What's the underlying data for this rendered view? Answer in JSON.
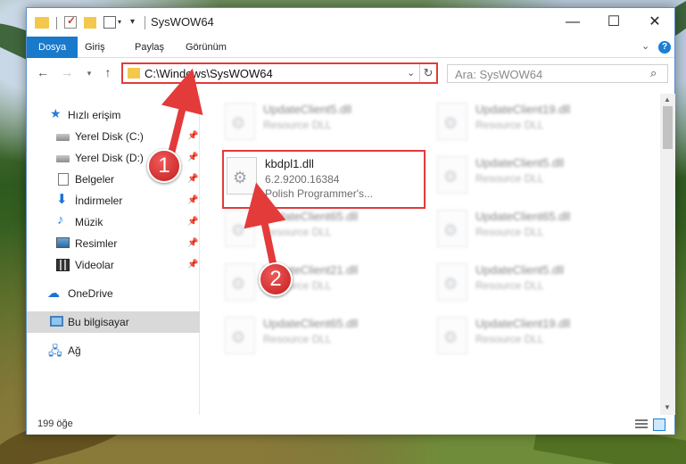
{
  "window": {
    "title": "SysWOW64",
    "controls": {
      "minimize": "—",
      "maximize": "☐",
      "close": "✕"
    }
  },
  "ribbon": {
    "tabs": [
      {
        "label": "Dosya",
        "active": true
      },
      {
        "label": "Giriş"
      },
      {
        "label": "Paylaş"
      },
      {
        "label": "Görünüm"
      }
    ],
    "help": "?"
  },
  "navigation": {
    "address": "C:\\Windows\\SysWOW64",
    "search_placeholder": "Ara: SysWOW64"
  },
  "sidebar": {
    "items": [
      {
        "label": "Hızlı erişim",
        "icon": "star-icon"
      },
      {
        "label": "Yerel Disk (C:)",
        "icon": "disk-icon",
        "pinned": true
      },
      {
        "label": "Yerel Disk (D:)",
        "icon": "disk-icon",
        "pinned": true
      },
      {
        "label": "Belgeler",
        "icon": "document-icon",
        "pinned": true
      },
      {
        "label": "İndirmeler",
        "icon": "download-icon",
        "pinned": true
      },
      {
        "label": "Müzik",
        "icon": "music-icon",
        "pinned": true
      },
      {
        "label": "Resimler",
        "icon": "pictures-icon",
        "pinned": true
      },
      {
        "label": "Videolar",
        "icon": "video-icon",
        "pinned": true
      },
      {
        "label": "OneDrive",
        "icon": "cloud-icon"
      },
      {
        "label": "Bu bilgisayar",
        "icon": "computer-icon",
        "selected": true
      },
      {
        "label": "Ağ",
        "icon": "network-icon"
      }
    ]
  },
  "files": {
    "left": [
      {
        "name": "UpdateClient5.dll",
        "sub": "Resource DLL"
      },
      {
        "name": "kbdpl1.dll",
        "version": "6.2.9200.16384",
        "description": "Polish Programmer's...",
        "highlighted": true
      },
      {
        "name": "UpdateClient65.dll",
        "sub": "Resource DLL"
      },
      {
        "name": "UpdateClient21.dll",
        "sub": "Resource DLL"
      },
      {
        "name": "UpdateClient65.dll",
        "sub": "Resource DLL"
      }
    ],
    "right": [
      {
        "name": "UpdateClient19.dll",
        "sub": "Resource DLL"
      },
      {
        "name": "UpdateClient5.dll",
        "sub": "Resource DLL"
      },
      {
        "name": "UpdateClient65.dll",
        "sub": "Resource DLL"
      },
      {
        "name": "UpdateClient5.dll",
        "sub": "Resource DLL"
      },
      {
        "name": "UpdateClient19.dll",
        "sub": "Resource DLL"
      }
    ]
  },
  "status": {
    "count": "199 öğe"
  },
  "annotations": {
    "step1": "1",
    "step2": "2",
    "color": "#e33a3a"
  }
}
